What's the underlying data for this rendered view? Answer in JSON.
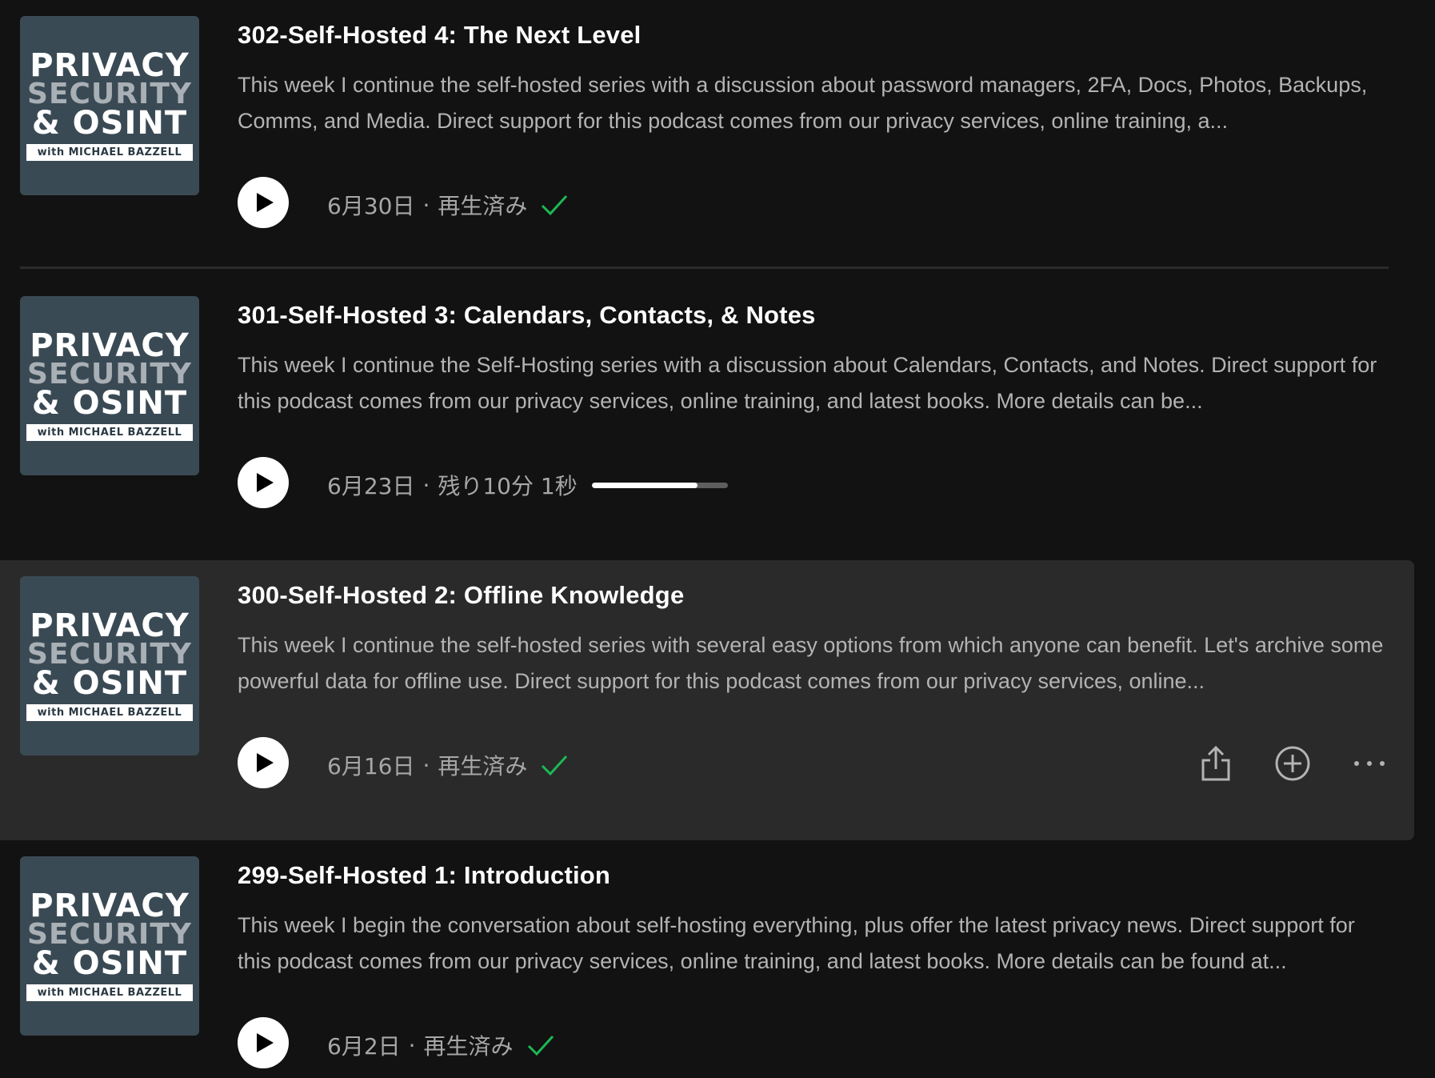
{
  "podcast_art": {
    "line1": "PRIVACY",
    "line2": "SECURITY",
    "line3": "& OSINT",
    "line4": "with MICHAEL BAZZELL"
  },
  "meta_separator": "·",
  "colors": {
    "background": "#121212",
    "row_hover": "#2a2a2a",
    "played_check": "#1db954",
    "progress_track": "#5e5e5e",
    "progress_fill": "#ffffff"
  },
  "episodes": [
    {
      "title": "302-Self-Hosted 4: The Next Level",
      "description": "This week I continue the self-hosted series with a discussion about password managers, 2FA, Docs, Photos, Backups, Comms, and Media. Direct support for this podcast comes from our privacy services, online training, a...",
      "date": "6月30日",
      "status": "再生済み",
      "played": true
    },
    {
      "title": "301-Self-Hosted 3: Calendars, Contacts, & Notes",
      "description": "This week I continue the Self-Hosting series with a discussion about Calendars, Contacts, and Notes. Direct support for this podcast comes from our privacy services, online training, and latest books. More details can be...",
      "date": "6月23日",
      "status": "残り10分 1秒",
      "played": false,
      "progress": 0.78
    },
    {
      "title": "300-Self-Hosted 2: Offline Knowledge",
      "description": "This week I continue the self-hosted series with several easy options from which anyone can benefit. Let's archive some powerful data for offline use. Direct support for this podcast comes from our privacy services, online...",
      "date": "6月16日",
      "status": "再生済み",
      "played": true,
      "hovered": true
    },
    {
      "title": "299-Self-Hosted 1: Introduction",
      "description": "This week I begin the conversation about self-hosting everything, plus offer the latest privacy news. Direct support for this podcast comes from our privacy services, online training, and latest books. More details can be found at...",
      "date": "6月2日",
      "status": "再生済み",
      "played": true
    }
  ],
  "row_actions": {
    "share_icon": "share-icon",
    "add_icon": "plus-circle-icon",
    "more_icon": "more-horizontal-icon"
  }
}
